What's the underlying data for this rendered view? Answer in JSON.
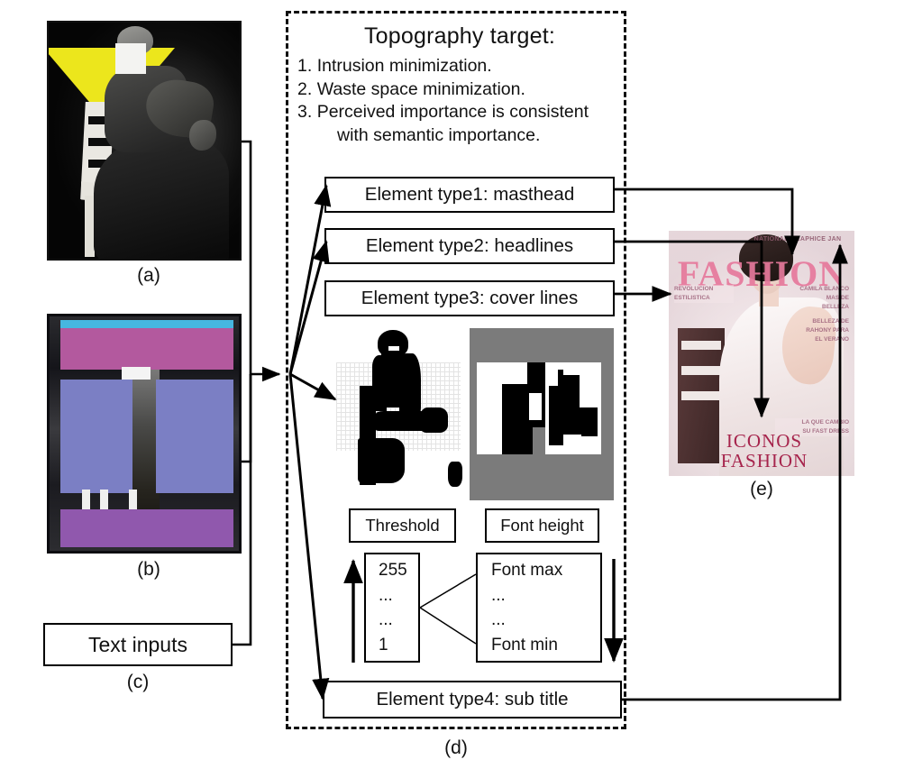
{
  "panel_d": {
    "title": "Topography target:",
    "goals": [
      {
        "num": "1.",
        "text": "Intrusion minimization."
      },
      {
        "num": "2.",
        "text": "Waste space minimization."
      },
      {
        "num": "3.",
        "text": "Perceived importance is consistent",
        "cont": "with semantic importance."
      }
    ],
    "element_types": [
      {
        "label": "Element type1: masthead"
      },
      {
        "label": "Element type2: headlines"
      },
      {
        "label": "Element type3: cover lines"
      },
      {
        "label": "Element type4: sub title"
      }
    ],
    "threshold": {
      "caption": "Threshold",
      "values": [
        "255",
        "...",
        "...",
        "1"
      ]
    },
    "font_height": {
      "caption": "Font height",
      "values": [
        "Font max",
        "...",
        "...",
        "Font min"
      ]
    }
  },
  "inputs": {
    "text_inputs_label": "Text inputs"
  },
  "captions": {
    "a": "(a)",
    "b": "(b)",
    "c": "(c)",
    "d": "(d)",
    "e": "(e)"
  },
  "cover": {
    "top_line": "NATIONAL GRAPHICE JAN",
    "masthead": "FASHION",
    "cover_line_left": "REVOLUCION\nESTILISTICA",
    "cover_line_right_1": "CAMILA BLANCO\nMAS DE\nBELLEZA",
    "cover_line_right_2": "BELLEZA DE\nRAHONY PARA\nEL VERANO",
    "cover_line_right_3": "LA QUE CAMBIO\nSU FAST DRESS",
    "sub_title_line1": "ICONOS",
    "sub_title_line2": "FASHION"
  },
  "colors": {
    "accent_pink": "#e6799c",
    "sub_title_red": "#a6244c",
    "triangle_yellow": "#ece61c",
    "block_cyan": "#46b7e0",
    "block_magenta": "#b3599e",
    "block_blue": "#7b7fc4",
    "block_purple": "#9058ad",
    "line_black": "#000000",
    "binary_gray": "#7b7b7b"
  }
}
